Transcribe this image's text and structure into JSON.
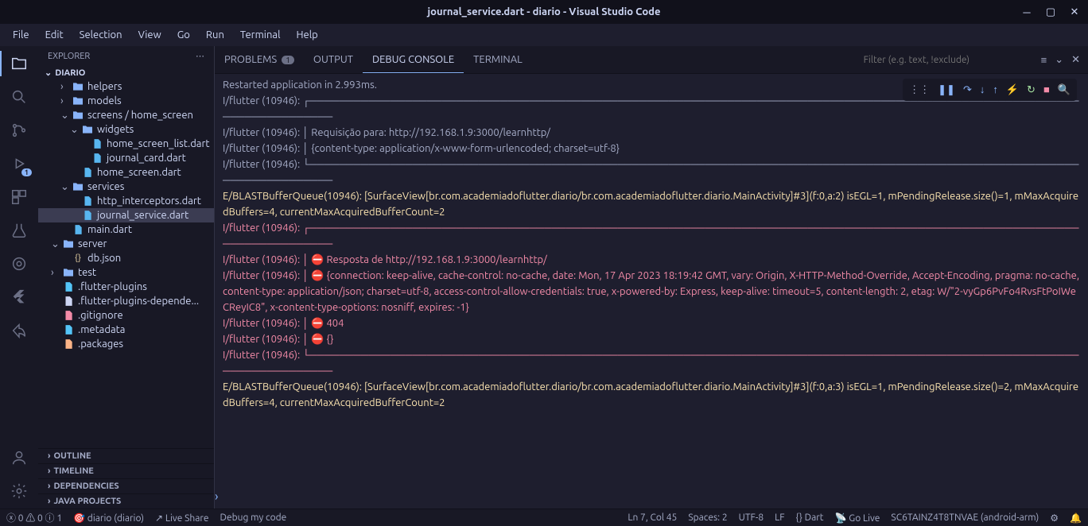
{
  "title": "journal_service.dart - diario - Visual Studio Code",
  "menubar": [
    "File",
    "Edit",
    "Selection",
    "View",
    "Go",
    "Run",
    "Terminal",
    "Help"
  ],
  "sidebar": {
    "header": "EXPLORER",
    "project": "DIARIO",
    "tree": [
      {
        "indent": 2,
        "chev": ">",
        "icon": "folder-help",
        "label": "helpers"
      },
      {
        "indent": 2,
        "chev": ">",
        "icon": "folder-models",
        "label": "models"
      },
      {
        "indent": 2,
        "chev": "v",
        "icon": "folder-screens",
        "label": "screens / home_screen"
      },
      {
        "indent": 3,
        "chev": "v",
        "icon": "folder-widgets",
        "label": "widgets"
      },
      {
        "indent": 4,
        "chev": "",
        "icon": "dart",
        "label": "home_screen_list.dart"
      },
      {
        "indent": 4,
        "chev": "",
        "icon": "dart",
        "label": "journal_card.dart"
      },
      {
        "indent": 3,
        "chev": "",
        "icon": "dart",
        "label": "home_screen.dart"
      },
      {
        "indent": 2,
        "chev": "v",
        "icon": "folder-services",
        "label": "services"
      },
      {
        "indent": 3,
        "chev": "",
        "icon": "dart",
        "label": "http_interceptors.dart"
      },
      {
        "indent": 3,
        "chev": "",
        "icon": "dart",
        "label": "journal_service.dart",
        "selected": true
      },
      {
        "indent": 2,
        "chev": "",
        "icon": "dart",
        "label": "main.dart"
      },
      {
        "indent": 1,
        "chev": "v",
        "icon": "folder-server",
        "label": "server"
      },
      {
        "indent": 2,
        "chev": "",
        "icon": "json",
        "label": "db.json"
      },
      {
        "indent": 1,
        "chev": ">",
        "icon": "folder-test",
        "label": "test"
      },
      {
        "indent": 1,
        "chev": "",
        "icon": "flutter",
        "label": ".flutter-plugins"
      },
      {
        "indent": 1,
        "chev": "",
        "icon": "file",
        "label": ".flutter-plugins-depende..."
      },
      {
        "indent": 1,
        "chev": "",
        "icon": "git",
        "label": ".gitignore"
      },
      {
        "indent": 1,
        "chev": "",
        "icon": "flutter",
        "label": ".metadata"
      },
      {
        "indent": 1,
        "chev": "",
        "icon": "package",
        "label": ".packages"
      }
    ],
    "collapsed": [
      "OUTLINE",
      "TIMELINE",
      "DEPENDENCIES",
      "JAVA PROJECTS"
    ]
  },
  "tabs": {
    "items": [
      "PROBLEMS",
      "OUTPUT",
      "DEBUG CONSOLE",
      "TERMINAL"
    ],
    "active": 2,
    "problems_count": "1",
    "filter_placeholder": "Filter (e.g. text, !exclude)"
  },
  "console": {
    "lines": [
      {
        "cls": "muted",
        "text": "Restarted application in 2.993ms."
      },
      {
        "cls": "muted",
        "text": "I/flutter (10946): ┌────────────────────────────────────────────────────────────────────────────────────────────────────────────────────────"
      },
      {
        "cls": "muted",
        "text": "I/flutter (10946): │ Requisição para: http://192.168.1.9:3000/learnhttp/"
      },
      {
        "cls": "muted",
        "text": "I/flutter (10946): │ {content-type: application/x-www-form-urlencoded; charset=utf-8}"
      },
      {
        "cls": "muted",
        "text": "I/flutter (10946): └────────────────────────────────────────────────────────────────────────────────────────────────────────────────────────"
      },
      {
        "cls": "gold",
        "text": "E/BLASTBufferQueue(10946): [SurfaceView[br.com.academiadoflutter.diario/br.com.academiadoflutter.diario.MainActivity]#3](f:0,a:2) isEGL=1, mPendingRelease.size()=1, mMaxAcquiredBuffers=4, currentMaxAcquiredBufferCount=2"
      },
      {
        "cls": "red",
        "text": "I/flutter (10946): ┌────────────────────────────────────────────────────────────────────────────────────────────────────────────────────────"
      },
      {
        "cls": "red",
        "text": "I/flutter (10946): │ ⛔ Resposta de http://192.168.1.9:3000/learnhttp/"
      },
      {
        "cls": "red",
        "text": "I/flutter (10946): │ ⛔ {connection: keep-alive, cache-control: no-cache, date: Mon, 17 Apr 2023 18:19:42 GMT, vary: Origin, X-HTTP-Method-Override, Accept-Encoding, pragma: no-cache, content-type: application/json; charset=utf-8, access-control-allow-credentials: true, x-powered-by: Express, keep-alive: timeout=5, content-length: 2, etag: W/\"2-vyGp6PvFo4RvsFtPoIWeCReyIC8\", x-content-type-options: nosniff, expires: -1}"
      },
      {
        "cls": "red",
        "text": "I/flutter (10946): │ ⛔ 404"
      },
      {
        "cls": "red",
        "text": "I/flutter (10946): │ ⛔ {}"
      },
      {
        "cls": "red",
        "text": "I/flutter (10946): └────────────────────────────────────────────────────────────────────────────────────────────────────────────────────────"
      },
      {
        "cls": "gold",
        "text": "E/BLASTBufferQueue(10946): [SurfaceView[br.com.academiadoflutter.diario/br.com.academiadoflutter.diario.MainActivity]#3](f:0,a:3) isEGL=1, mPendingRelease.size()=2, mMaxAcquiredBuffers=4, currentMaxAcquiredBufferCount=2"
      }
    ]
  },
  "status": {
    "errors": "0",
    "warnings": "0",
    "info": "1",
    "profile": "diario (diario)",
    "liveshare": "Live Share",
    "debug": "Debug my code",
    "pos": "Ln 7, Col 45",
    "spaces": "Spaces: 2",
    "enc": "UTF-8",
    "eol": "LF",
    "lang": "{} Dart",
    "golive": "Go Live",
    "device": "SC6TAINZ4T8TNVAE (android-arm)"
  }
}
